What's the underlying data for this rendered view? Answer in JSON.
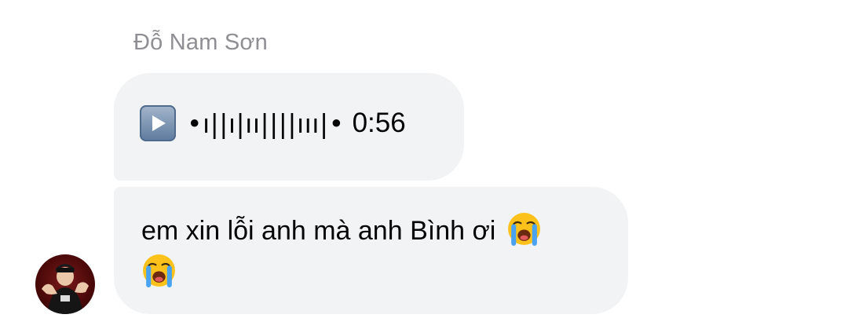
{
  "conversation": {
    "sender_name": "Đỗ Nam Sơn",
    "avatar_icon": "user-avatar",
    "messages": [
      {
        "type": "voice",
        "play_icon": "play-button-icon",
        "waveform": "•ı||ı|ıı||||ııı|•",
        "duration": "0:56"
      },
      {
        "type": "text",
        "text": "em xin lỗi anh mà anh Bình ơi",
        "emojis": [
          "loudly-crying-face-icon",
          "loudly-crying-face-icon"
        ]
      }
    ]
  },
  "colors": {
    "bubble_bg": "#f2f3f5",
    "sender_name": "#8e8e93",
    "text": "#050505"
  }
}
